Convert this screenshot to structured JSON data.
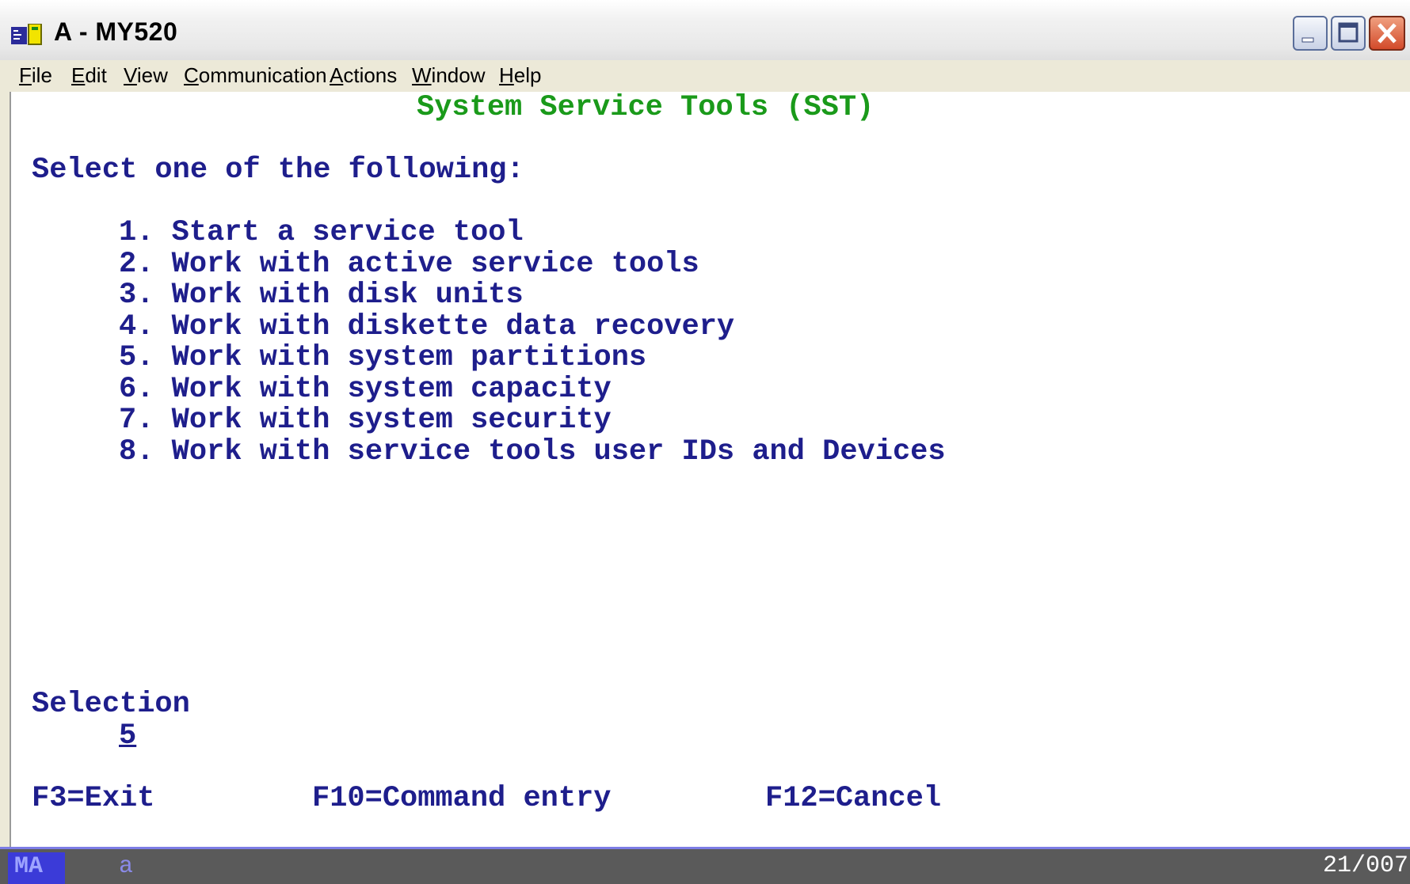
{
  "window": {
    "title": "A - MY520"
  },
  "menu": {
    "items": [
      {
        "label": "File",
        "mnemonic": "F",
        "rest": "ile"
      },
      {
        "label": "Edit",
        "mnemonic": "E",
        "rest": "dit"
      },
      {
        "label": "View",
        "mnemonic": "V",
        "rest": "iew"
      },
      {
        "label": "Communication",
        "mnemonic": "C",
        "rest": "ommunication"
      },
      {
        "label": "Actions",
        "mnemonic": "A",
        "rest": "ctions"
      },
      {
        "label": "Window",
        "mnemonic": "W",
        "rest": "indow"
      },
      {
        "label": "Help",
        "mnemonic": "H",
        "rest": "elp"
      }
    ]
  },
  "screen": {
    "title": "System Service Tools (SST)",
    "prompt": "Select one of the following:",
    "options": [
      "1. Start a service tool",
      "2. Work with active service tools",
      "3. Work with disk units",
      "4. Work with diskette data recovery",
      "5. Work with system partitions",
      "6. Work with system capacity",
      "7. Work with system security",
      "8. Work with service tools user IDs and Devices"
    ],
    "selection_label": "Selection",
    "selection_value": "5",
    "function_keys": {
      "f3": "F3=Exit",
      "f10": "F10=Command entry",
      "f12": "F12=Cancel"
    }
  },
  "status": {
    "mode": "MA",
    "indicator": "a",
    "cursor_position": "21/007"
  },
  "colors": {
    "title_green": "#1a9a1a",
    "text_blue": "#1e1e8c",
    "status_bar": "#5a5a5a"
  }
}
